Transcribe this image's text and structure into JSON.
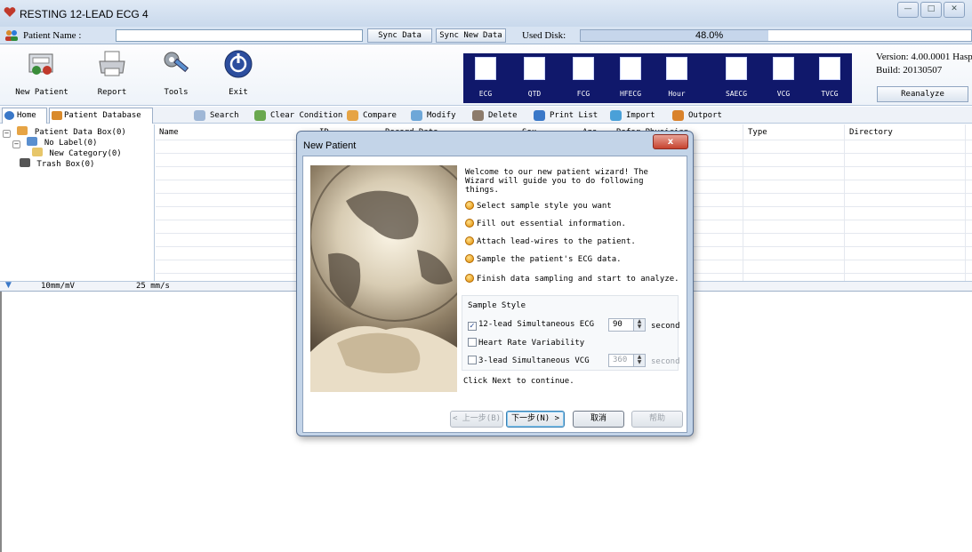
{
  "window": {
    "title": "RESTING 12-LEAD ECG 4",
    "controls": [
      "—",
      "□",
      "✕"
    ]
  },
  "namebar": {
    "patient_name_label": "Patient Name :",
    "patient_name_value": "",
    "sync_data": "Sync Data",
    "sync_new_data": "Sync New Data",
    "used_disk_label": "Used Disk:",
    "used_disk_fraction": 0.48,
    "used_disk_text": "48.0%"
  },
  "toolbar": {
    "buttons": [
      {
        "label": "New Patient",
        "icon": "new-patient-icon"
      },
      {
        "label": "Report",
        "icon": "printer-icon"
      },
      {
        "label": "Tools",
        "icon": "tools-icon"
      },
      {
        "label": "Exit",
        "icon": "power-icon"
      }
    ],
    "modules": [
      "ECG",
      "QTD",
      "FCG",
      "HFECG",
      "Hour",
      "SAECG",
      "VCG",
      "TVCG"
    ],
    "version": "Version: 4.00.0001 Hasp",
    "build": "Build:   20130507",
    "reanalyze": "Reanalyze"
  },
  "tabs": {
    "home": "Home",
    "patient_database": "Patient Database"
  },
  "actions": [
    "Search",
    "Clear Condition",
    "Compare",
    "Modify",
    "Delete",
    "Print List",
    "Import",
    "Outport"
  ],
  "tree": {
    "root": "Patient Data Box(0)",
    "no_label": "No Label(0)",
    "new_category": "New Category(0)",
    "trash": "Trash Box(0)"
  },
  "grid": {
    "columns": [
      "Name",
      "ID",
      "Record Date",
      "Sex",
      "Age",
      "Refer Physician",
      "Type",
      "Directory"
    ]
  },
  "scale": {
    "gain": "10mm/mV",
    "speed": "25 mm/s"
  },
  "dialog": {
    "title": "New Patient",
    "close": "x",
    "intro": "Welcome to our new patient wizard! The\nWizard will guide you to do following\nthings.",
    "steps": [
      "Select sample style you want",
      "Fill out essential information.",
      "Attach lead-wires to the patient.",
      "Sample the patient's ECG data.",
      "Finish data sampling and start to analyze."
    ],
    "sample_style_title": "Sample Style",
    "options": [
      {
        "label": "12-lead Simultaneous ECG",
        "checked": true,
        "seconds": "90",
        "unit": "second"
      },
      {
        "label": "Heart Rate Variability",
        "checked": false
      },
      {
        "label": "3-lead Simultaneous VCG",
        "checked": false,
        "seconds": "360",
        "unit": "second"
      }
    ],
    "next_note": "Click Next to continue.",
    "buttons": {
      "prev": "< 上一步(B)",
      "next": "下一步(N) >",
      "cancel": "取消",
      "help": "帮助"
    }
  },
  "colors": {
    "module_panel": "#10186b",
    "accent": "#3c7fb1"
  }
}
